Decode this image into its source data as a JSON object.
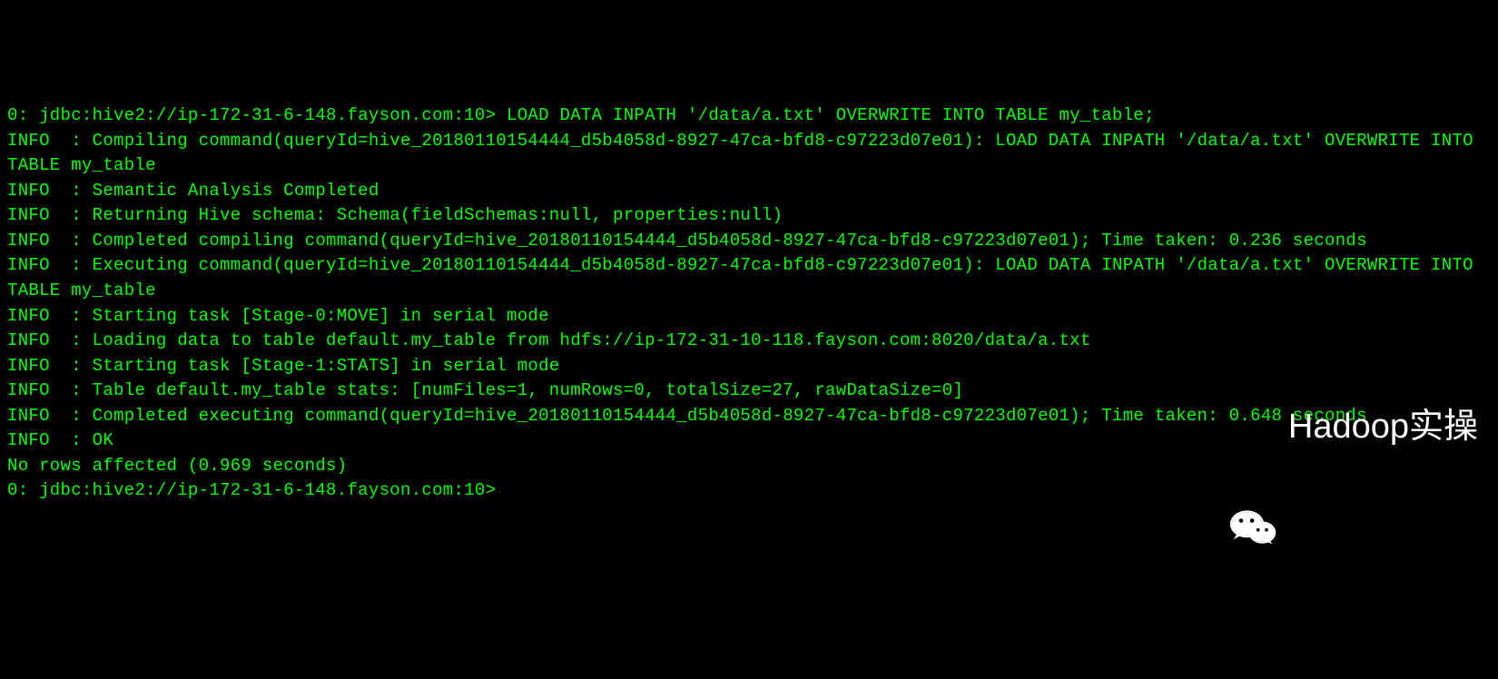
{
  "terminal": {
    "prompt1": "0: jdbc:hive2://ip-172-31-6-148.fayson.com:10>",
    "command": " LOAD DATA INPATH '/data/a.txt' OVERWRITE INTO TABLE my_table;",
    "lines": [
      "INFO  : Compiling command(queryId=hive_20180110154444_d5b4058d-8927-47ca-bfd8-c97223d07e01): LOAD DATA INPATH '/data/a.txt' OVERWRITE INTO TABLE my_table",
      "INFO  : Semantic Analysis Completed",
      "INFO  : Returning Hive schema: Schema(fieldSchemas:null, properties:null)",
      "INFO  : Completed compiling command(queryId=hive_20180110154444_d5b4058d-8927-47ca-bfd8-c97223d07e01); Time taken: 0.236 seconds",
      "INFO  : Executing command(queryId=hive_20180110154444_d5b4058d-8927-47ca-bfd8-c97223d07e01): LOAD DATA INPATH '/data/a.txt' OVERWRITE INTO TABLE my_table",
      "INFO  : Starting task [Stage-0:MOVE] in serial mode",
      "INFO  : Loading data to table default.my_table from hdfs://ip-172-31-10-118.fayson.com:8020/data/a.txt",
      "INFO  : Starting task [Stage-1:STATS] in serial mode",
      "INFO  : Table default.my_table stats: [numFiles=1, numRows=0, totalSize=27, rawDataSize=0]",
      "INFO  : Completed executing command(queryId=hive_20180110154444_d5b4058d-8927-47ca-bfd8-c97223d07e01); Time taken: 0.648 seconds",
      "INFO  : OK",
      "No rows affected (0.969 seconds)"
    ],
    "prompt2": "0: jdbc:hive2://ip-172-31-6-148.fayson.com:10>"
  },
  "watermark": {
    "text": "Hadoop实操",
    "icon": "wechat-icon"
  }
}
